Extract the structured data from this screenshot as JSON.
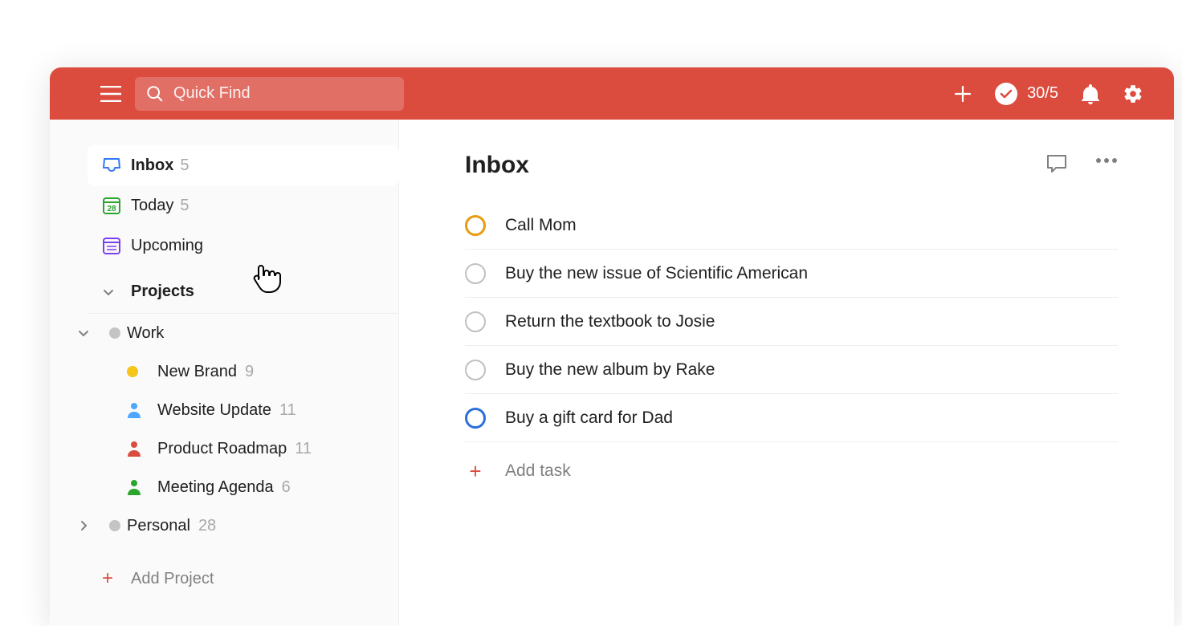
{
  "topbar": {
    "search_placeholder": "Quick Find",
    "karma_count": "30/5"
  },
  "sidebar": {
    "nav": [
      {
        "label": "Inbox",
        "count": "5",
        "icon": "inbox"
      },
      {
        "label": "Today",
        "count": "5",
        "icon": "today",
        "day": "28"
      },
      {
        "label": "Upcoming",
        "count": "",
        "icon": "upcoming"
      }
    ],
    "projects_label": "Projects",
    "folders": [
      {
        "label": "Work",
        "expanded": true,
        "projects": [
          {
            "label": "New Brand",
            "count": "9",
            "icon": "yellow-dot"
          },
          {
            "label": "Website Update",
            "count": "11",
            "icon": "person-blue"
          },
          {
            "label": "Product Roadmap",
            "count": "11",
            "icon": "person-red"
          },
          {
            "label": "Meeting Agenda",
            "count": "6",
            "icon": "person-green"
          }
        ]
      },
      {
        "label": "Personal",
        "count": "28",
        "expanded": false
      }
    ],
    "add_project_label": "Add Project"
  },
  "main": {
    "title": "Inbox",
    "tasks": [
      {
        "title": "Call Mom",
        "priority": "orange"
      },
      {
        "title": "Buy the new issue of Scientific American",
        "priority": "none"
      },
      {
        "title": "Return the textbook to Josie",
        "priority": "none"
      },
      {
        "title": "Buy the new album by Rake",
        "priority": "none"
      },
      {
        "title": "Buy a gift card for Dad",
        "priority": "blue"
      }
    ],
    "add_task_label": "Add task"
  }
}
